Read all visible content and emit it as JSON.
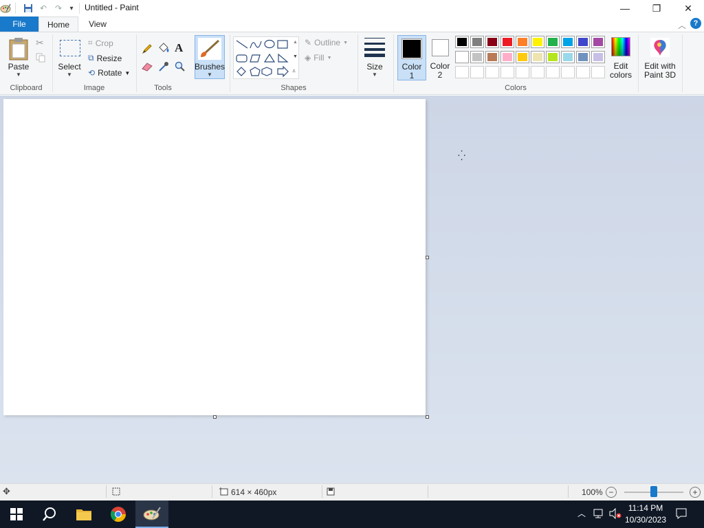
{
  "window": {
    "title": "Untitled - Paint",
    "minimize_glyph": "—",
    "maximize_glyph": "❐",
    "close_glyph": "✕"
  },
  "tabs": {
    "file": "File",
    "home": "Home",
    "view": "View"
  },
  "clipboard": {
    "paste_label": "Paste",
    "group_label": "Clipboard"
  },
  "image": {
    "select_label": "Select",
    "crop_label": "Crop",
    "resize_label": "Resize",
    "rotate_label": "Rotate",
    "group_label": "Image"
  },
  "tools": {
    "group_label": "Tools",
    "brushes_label": "Brushes"
  },
  "shapes": {
    "outline_label": "Outline",
    "fill_label": "Fill",
    "group_label": "Shapes"
  },
  "size": {
    "label": "Size"
  },
  "colors": {
    "color1_label": "Color",
    "color1_num": "1",
    "color2_label": "Color",
    "color2_num": "2",
    "group_label": "Colors",
    "edit_colors_line1": "Edit",
    "edit_colors_line2": "colors",
    "edit_paint3d_line1": "Edit with",
    "edit_paint3d_line2": "Paint 3D",
    "color1_value": "#000000",
    "color2_value": "#ffffff",
    "palette_row1": [
      "#000000",
      "#7f7f7f",
      "#880015",
      "#ed1c24",
      "#ff7f27",
      "#fff200",
      "#22b14c",
      "#00a2e8",
      "#3f48cc",
      "#a349a4"
    ],
    "palette_row2": [
      "#ffffff",
      "#c3c3c3",
      "#b97a57",
      "#ffaec9",
      "#ffc90e",
      "#efe4b0",
      "#b5e61d",
      "#99d9ea",
      "#7092be",
      "#c8bfe7"
    ]
  },
  "status": {
    "canvas_size": "614 × 460px",
    "zoom": "100%",
    "zoom_level": 0.5
  },
  "taskbar": {
    "time": "11:14 PM",
    "date": "10/30/2023"
  }
}
